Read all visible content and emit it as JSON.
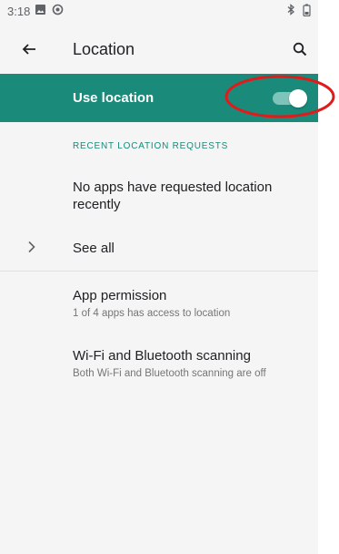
{
  "status_bar": {
    "time": "3:18",
    "left_icons": [
      "image-icon",
      "sync-icon"
    ],
    "right_icons": [
      "bluetooth-icon",
      "battery-icon"
    ]
  },
  "app_bar": {
    "title": "Location",
    "back_icon": "arrow-left-icon",
    "search_icon": "search-icon"
  },
  "master_switch": {
    "label": "Use location",
    "checked": true,
    "background_color": "#1a8a7a"
  },
  "recent_requests": {
    "header": "RECENT LOCATION REQUESTS",
    "empty_message": "No apps have requested location recently",
    "see_all_label": "See all"
  },
  "preferences": [
    {
      "title": "App permission",
      "summary": "1 of 4 apps has access to location"
    },
    {
      "title": "Wi-Fi and Bluetooth scanning",
      "summary": "Both Wi-Fi and Bluetooth scanning are off"
    }
  ],
  "annotation": {
    "color": "#e01b1b"
  }
}
